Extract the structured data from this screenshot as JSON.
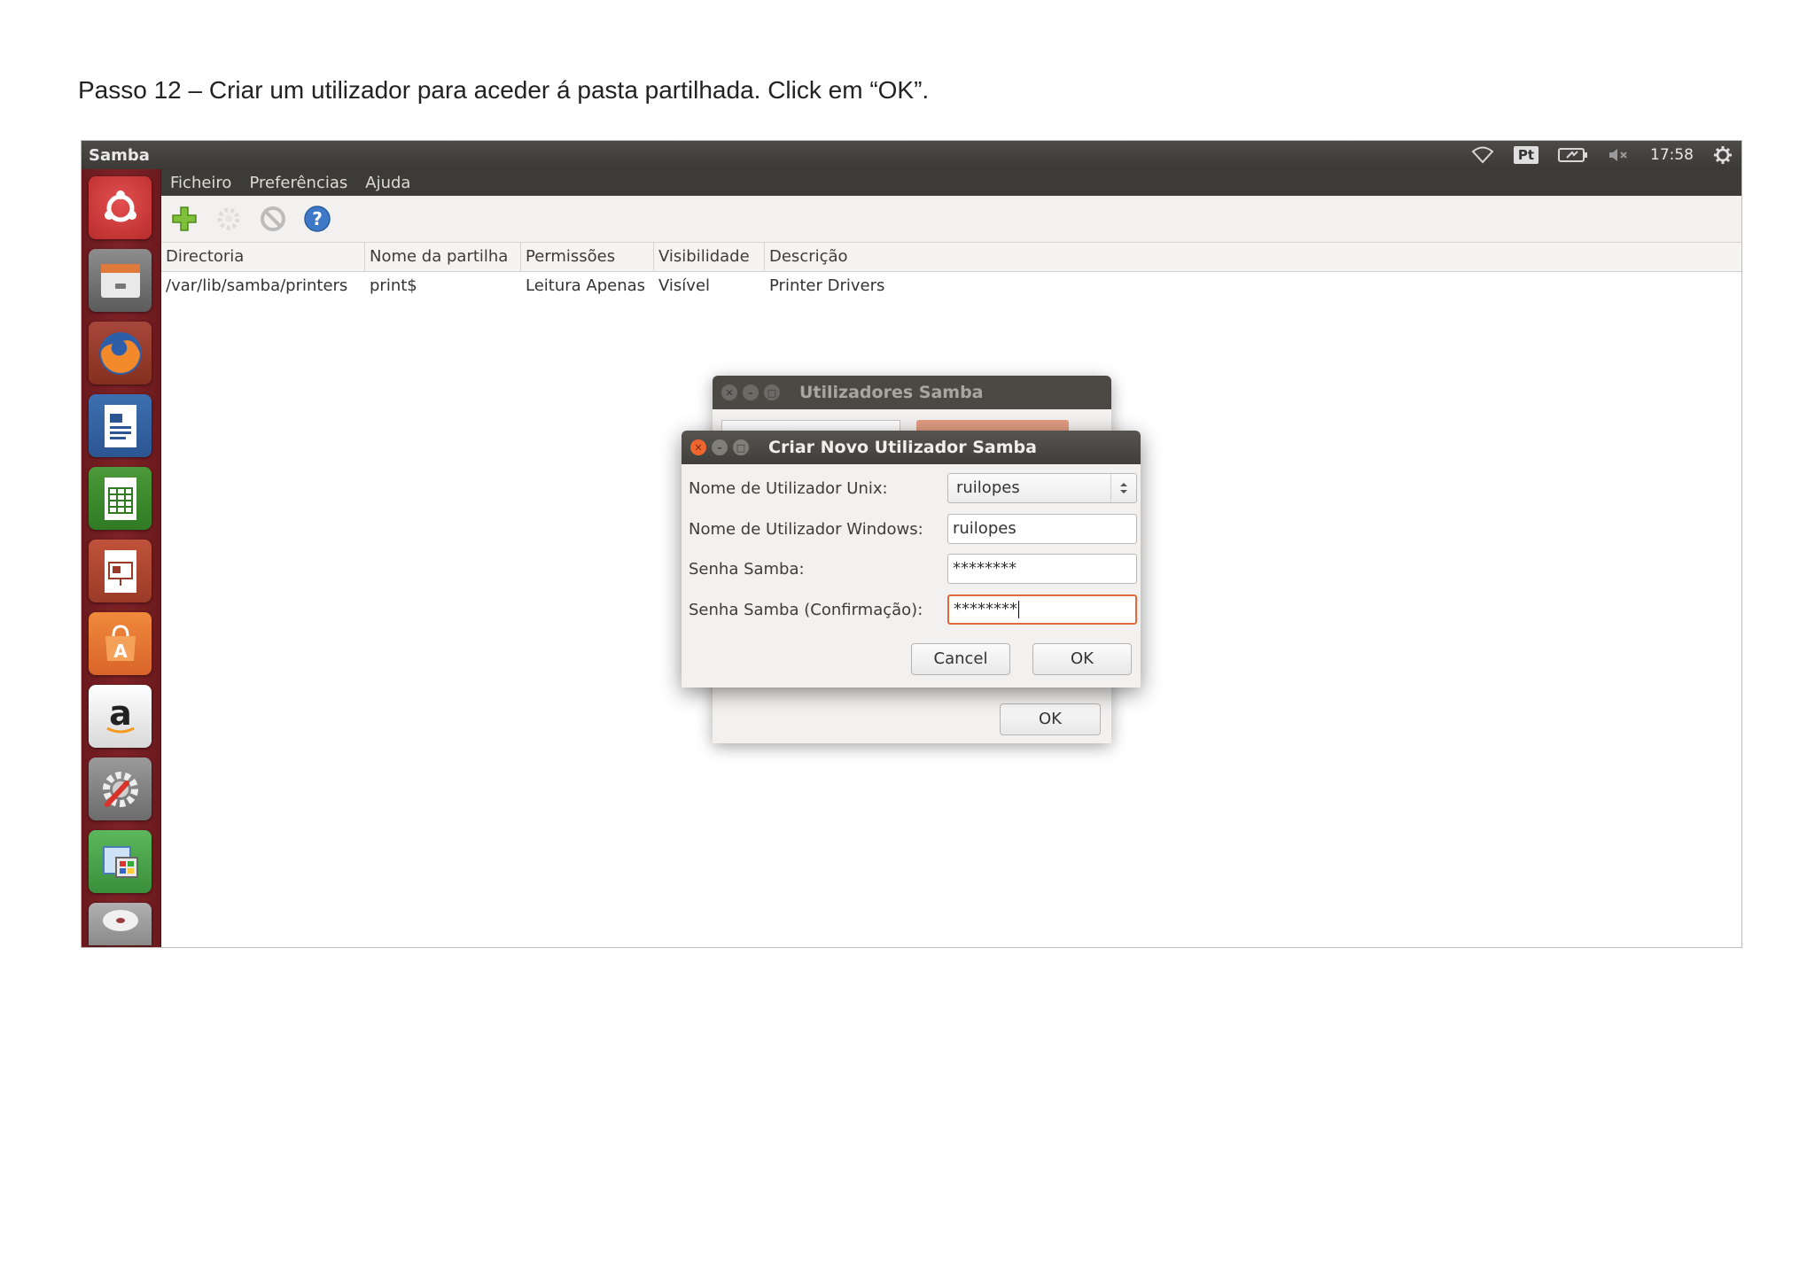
{
  "caption": "Passo 12 – Criar um utilizador para aceder á pasta partilhada. Click em “OK”.",
  "panel": {
    "app_title": "Samba",
    "keyboard": "Pt",
    "time": "17:58",
    "icons": [
      "wifi-icon",
      "keyboard-layout-indicator",
      "battery-icon",
      "volume-muted-icon",
      "settings-gear-icon"
    ]
  },
  "launcher": {
    "icons": [
      "ubuntu-dash-icon",
      "files-icon",
      "firefox-icon",
      "writer-icon",
      "calc-icon",
      "impress-icon",
      "software-center-icon",
      "amazon-icon",
      "system-settings-icon",
      "samba-icon",
      "dvd-icon"
    ]
  },
  "menu": {
    "file": "Ficheiro",
    "prefs": "Preferências",
    "help": "Ajuda"
  },
  "toolbar": {
    "icons": [
      "add-share-icon",
      "properties-icon",
      "delete-icon",
      "help-icon"
    ]
  },
  "table": {
    "columns": [
      "Directoria",
      "Nome da partilha",
      "Permissões",
      "Visibilidade",
      "Descrição"
    ],
    "rows": [
      [
        "/var/lib/samba/printers",
        "print$",
        "Leitura Apenas",
        "Visível",
        "Printer Drivers"
      ]
    ]
  },
  "bg_dialog": {
    "title": "Utilizadores Samba",
    "ok": "OK"
  },
  "dialog": {
    "title": "Criar Novo Utilizador Samba",
    "unix_label": "Nome de Utilizador Unix:",
    "unix_value": "ruilopes",
    "windows_label": "Nome de Utilizador Windows:",
    "windows_value": "ruilopes",
    "pass_label": "Senha Samba:",
    "pass_value": "********",
    "confirm_label": "Senha Samba (Confirmação):",
    "confirm_value": "********",
    "cancel": "Cancel",
    "ok": "OK"
  }
}
